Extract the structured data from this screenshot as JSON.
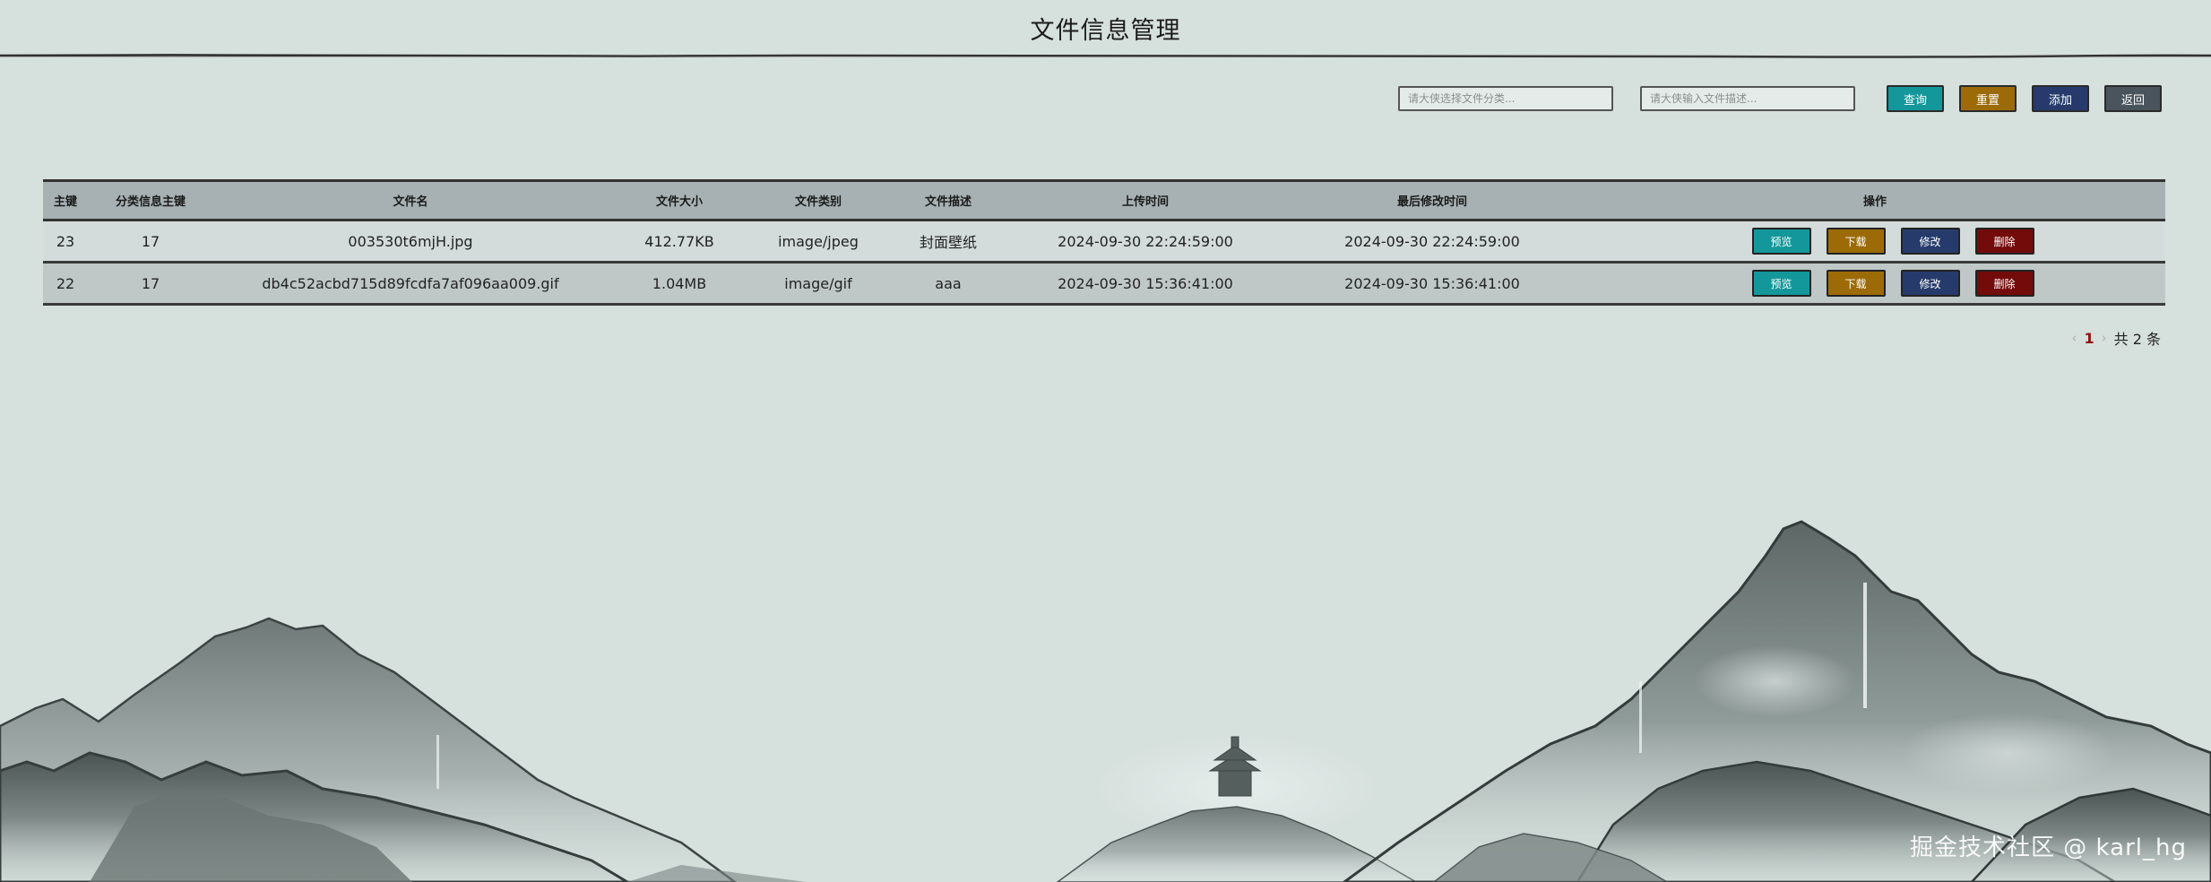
{
  "header": {
    "title": "文件信息管理"
  },
  "toolbar": {
    "category_placeholder": "请大侠选择文件分类...",
    "desc_placeholder": "请大侠输入文件描述...",
    "query_label": "查询",
    "reset_label": "重置",
    "add_label": "添加",
    "back_label": "返回"
  },
  "table": {
    "columns": [
      "主键",
      "分类信息主键",
      "文件名",
      "文件大小",
      "文件类别",
      "文件描述",
      "上传时间",
      "最后修改时间",
      "操作"
    ],
    "rows": [
      {
        "id": "23",
        "category_id": "17",
        "file_name": "003530t6mjH.jpg",
        "file_size": "412.77KB",
        "file_type": "image/jpeg",
        "file_desc": "封面壁纸",
        "upload_time": "2024-09-30 22:24:59:00",
        "modified_time": "2024-09-30 22:24:59:00"
      },
      {
        "id": "22",
        "category_id": "17",
        "file_name": "db4c52acbd715d89fcdfa7af096aa009.gif",
        "file_size": "1.04MB",
        "file_type": "image/gif",
        "file_desc": "aaa",
        "upload_time": "2024-09-30 15:36:41:00",
        "modified_time": "2024-09-30 15:36:41:00"
      }
    ],
    "actions": {
      "preview": "预览",
      "download": "下载",
      "edit": "修改",
      "delete": "删除"
    }
  },
  "pagination": {
    "prev": "‹",
    "current_page": "1",
    "next": "›",
    "total_text": "共 2 条"
  },
  "watermark": "掘金技术社区 @ karl_hg",
  "colors": {
    "background": "#d6e0dd",
    "header_row": "#a7b1b3",
    "teal": "#14979a",
    "gold": "#9c6b08",
    "navy": "#263b6b",
    "slate": "#4a545c",
    "red": "#730b0b",
    "page_active": "#8b1010"
  },
  "icons": [
    "chevron-left-icon",
    "chevron-right-icon"
  ]
}
